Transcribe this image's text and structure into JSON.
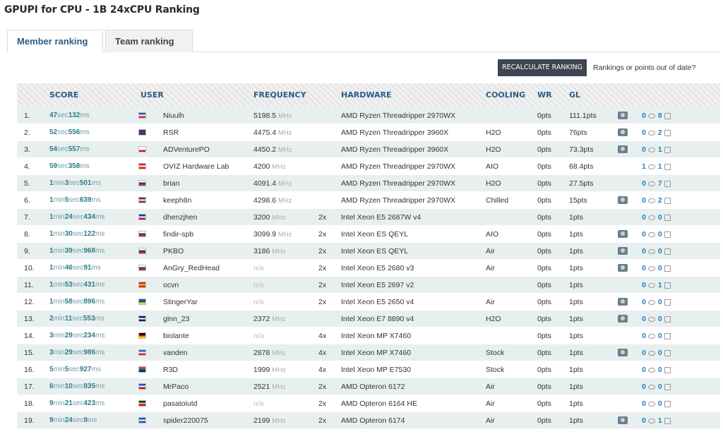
{
  "page": {
    "title": "GPUPI for CPU - 1B 24xCPU Ranking"
  },
  "tabs": [
    {
      "label": "Member ranking",
      "active": true
    },
    {
      "label": "Team ranking",
      "active": false
    }
  ],
  "toolbar": {
    "recalc_label": "RECALCULATE RANKING",
    "recalc_note": "Rankings or points out of date?"
  },
  "columns": {
    "score": "SCORE",
    "user": "USER",
    "frequency": "FREQUENCY",
    "hardware": "HARDWARE",
    "cooling": "COOLING",
    "wr": "WR",
    "gl": "GL"
  },
  "labels": {
    "mhz": "MHz",
    "na": "n/a"
  },
  "colors": {
    "accent": "#2b5d86",
    "score": "#2b7d86",
    "odd_row": "#e7f0ee",
    "button": "#3d4550",
    "count": "#2b7dba"
  },
  "rows": [
    {
      "rank": "1.",
      "score": [
        [
          "47",
          "sec"
        ],
        [
          "132",
          "ms"
        ]
      ],
      "flag": [
        "#2f5fb3",
        "#ffffff",
        "#d7263d"
      ],
      "user": "Niuulh",
      "freq": "5198.5",
      "cpus": "",
      "hw": "AMD Ryzen Threadripper 2970WX",
      "cooling": "",
      "wr": "0pts",
      "gl": "111.1pts",
      "cam": true,
      "comments": "0",
      "likes": "8"
    },
    {
      "rank": "2.",
      "score": [
        [
          "52",
          "sec"
        ],
        [
          "556",
          "ms"
        ]
      ],
      "flag": [
        "#1f3c88",
        "#c8102e",
        "#1f3c88"
      ],
      "user": "RSR",
      "freq": "4475.4",
      "cpus": "",
      "hw": "AMD Ryzen Threadripper 3960X",
      "cooling": "H2O",
      "wr": "0pts",
      "gl": "76pts",
      "cam": true,
      "comments": "0",
      "likes": "2"
    },
    {
      "rank": "3.",
      "score": [
        [
          "54",
          "sec"
        ],
        [
          "557",
          "ms"
        ]
      ],
      "flag": [
        "#ffffff",
        "#ffffff",
        "#dc143c"
      ],
      "user": "ADVenturePO",
      "freq": "4450.2",
      "cpus": "",
      "hw": "AMD Ryzen Threadripper 3960X",
      "cooling": "H2O",
      "wr": "0pts",
      "gl": "73.3pts",
      "cam": true,
      "comments": "0",
      "likes": "1"
    },
    {
      "rank": "4.",
      "score": [
        [
          "59",
          "sec"
        ],
        [
          "358",
          "ms"
        ]
      ],
      "flag": [
        "#d52b1e",
        "#ffffff",
        "#d52b1e"
      ],
      "user": "OVIZ Hardware Lab",
      "freq": "4200",
      "cpus": "",
      "hw": "AMD Ryzen Threadripper 2970WX",
      "cooling": "AIO",
      "wr": "0pts",
      "gl": "68.4pts",
      "cam": false,
      "comments": "1",
      "likes": "1"
    },
    {
      "rank": "5.",
      "score": [
        [
          "1",
          "min"
        ],
        [
          "3",
          "sec"
        ],
        [
          "501",
          "ms"
        ]
      ],
      "flag": [
        "#ffffff",
        "#0039a6",
        "#d52b1e"
      ],
      "user": "brian",
      "freq": "4091.4",
      "cpus": "",
      "hw": "AMD Ryzen Threadripper 2970WX",
      "cooling": "H2O",
      "wr": "0pts",
      "gl": "27.5pts",
      "cam": false,
      "comments": "0",
      "likes": "7"
    },
    {
      "rank": "6.",
      "score": [
        [
          "1",
          "min"
        ],
        [
          "5",
          "sec"
        ],
        [
          "639",
          "ms"
        ]
      ],
      "flag": [
        "#3c3b6e",
        "#ffffff",
        "#b22234"
      ],
      "user": "keeph8n",
      "freq": "4298.6",
      "cpus": "",
      "hw": "AMD Ryzen Threadripper 2970WX",
      "cooling": "Chilled",
      "wr": "0pts",
      "gl": "15pts",
      "cam": true,
      "comments": "0",
      "likes": "2"
    },
    {
      "rank": "7.",
      "score": [
        [
          "1",
          "min"
        ],
        [
          "24",
          "sec"
        ],
        [
          "434",
          "ms"
        ]
      ],
      "flag": [
        "#0038a8",
        "#ffffff",
        "#ce1126"
      ],
      "user": "dhenzjhen",
      "freq": "3200",
      "cpus": "2x",
      "hw": "Intel Xeon E5 2687W v4",
      "cooling": "",
      "wr": "0pts",
      "gl": "1pts",
      "cam": false,
      "comments": "0",
      "likes": "0"
    },
    {
      "rank": "8.",
      "score": [
        [
          "1",
          "min"
        ],
        [
          "30",
          "sec"
        ],
        [
          "122",
          "ms"
        ]
      ],
      "flag": [
        "#ffffff",
        "#0039a6",
        "#d52b1e"
      ],
      "user": "findir-spb",
      "freq": "3099.9",
      "cpus": "2x",
      "hw": "Intel Xeon ES QEYL",
      "cooling": "AIO",
      "wr": "0pts",
      "gl": "1pts",
      "cam": true,
      "comments": "0",
      "likes": "0"
    },
    {
      "rank": "9.",
      "score": [
        [
          "1",
          "min"
        ],
        [
          "39",
          "sec"
        ],
        [
          "968",
          "ms"
        ]
      ],
      "flag": [
        "#ffffff",
        "#11457e",
        "#d7141a"
      ],
      "user": "PKBO",
      "freq": "3186",
      "cpus": "2x",
      "hw": "Intel Xeon ES QEYL",
      "cooling": "Air",
      "wr": "0pts",
      "gl": "1pts",
      "cam": true,
      "comments": "0",
      "likes": "0"
    },
    {
      "rank": "10.",
      "score": [
        [
          "1",
          "min"
        ],
        [
          "46",
          "sec"
        ],
        [
          "91",
          "ms"
        ]
      ],
      "flag": [
        "#ffffff",
        "#0039a6",
        "#d52b1e"
      ],
      "user": "AnGry_RedHead",
      "freq": "",
      "cpus": "2x",
      "hw": "Intel Xeon E5 2680 v3",
      "cooling": "Air",
      "wr": "0pts",
      "gl": "1pts",
      "cam": true,
      "comments": "0",
      "likes": "0"
    },
    {
      "rank": "11.",
      "score": [
        [
          "1",
          "min"
        ],
        [
          "53",
          "sec"
        ],
        [
          "431",
          "ms"
        ]
      ],
      "flag": [
        "#da251d",
        "#ffcd00",
        "#da251d"
      ],
      "user": "ocvn",
      "freq": "",
      "cpus": "2x",
      "hw": "Intel Xeon E5 2697 v2",
      "cooling": "",
      "wr": "0pts",
      "gl": "1pts",
      "cam": false,
      "comments": "0",
      "likes": "1"
    },
    {
      "rank": "12.",
      "score": [
        [
          "1",
          "min"
        ],
        [
          "58",
          "sec"
        ],
        [
          "896",
          "ms"
        ]
      ],
      "flag": [
        "#0057b7",
        "#0057b7",
        "#ffd700"
      ],
      "user": "StingerYar",
      "freq": "",
      "cpus": "2x",
      "hw": "Intel Xeon E5 2650 v4",
      "cooling": "Air",
      "wr": "0pts",
      "gl": "1pts",
      "cam": true,
      "comments": "0",
      "likes": "0"
    },
    {
      "rank": "13.",
      "score": [
        [
          "2",
          "min"
        ],
        [
          "11",
          "sec"
        ],
        [
          "553",
          "ms"
        ]
      ],
      "flag": [
        "#00247d",
        "#ffffff",
        "#00247d"
      ],
      "user": "glnn_23",
      "freq": "2372",
      "cpus": "",
      "hw": "Intel Xeon E7 8890 v4",
      "cooling": "H2O",
      "wr": "0pts",
      "gl": "1pts",
      "cam": true,
      "comments": "0",
      "likes": "0"
    },
    {
      "rank": "14.",
      "score": [
        [
          "3",
          "min"
        ],
        [
          "29",
          "sec"
        ],
        [
          "234",
          "ms"
        ]
      ],
      "flag": [
        "#000000",
        "#dd0000",
        "#ffce00"
      ],
      "user": "biolante",
      "freq": "",
      "cpus": "4x",
      "hw": "Intel Xeon MP X7460",
      "cooling": "",
      "wr": "0pts",
      "gl": "1pts",
      "cam": false,
      "comments": "0",
      "likes": "0"
    },
    {
      "rank": "15.",
      "score": [
        [
          "3",
          "min"
        ],
        [
          "29",
          "sec"
        ],
        [
          "986",
          "ms"
        ]
      ],
      "flag": [
        "#2f5fb3",
        "#ffffff",
        "#d7263d"
      ],
      "user": "vanden",
      "freq": "2878",
      "cpus": "4x",
      "hw": "Intel Xeon MP X7460",
      "cooling": "Stock",
      "wr": "0pts",
      "gl": "1pts",
      "cam": true,
      "comments": "0",
      "likes": "0"
    },
    {
      "rank": "16.",
      "score": [
        [
          "5",
          "min"
        ],
        [
          "5",
          "sec"
        ],
        [
          "927",
          "ms"
        ]
      ],
      "flag": [
        "#de3831",
        "#007a4d",
        "#002395"
      ],
      "user": "R3D",
      "freq": "1999",
      "cpus": "4x",
      "hw": "Intel Xeon MP E7530",
      "cooling": "Stock",
      "wr": "0pts",
      "gl": "1pts",
      "cam": false,
      "comments": "0",
      "likes": "0"
    },
    {
      "rank": "17.",
      "score": [
        [
          "6",
          "min"
        ],
        [
          "10",
          "sec"
        ],
        [
          "835",
          "ms"
        ]
      ],
      "flag": [
        "#0050f0",
        "#ffffff",
        "#ed0000"
      ],
      "user": "MrPaco",
      "freq": "2521",
      "cpus": "2x",
      "hw": "AMD Opteron 6172",
      "cooling": "Air",
      "wr": "0pts",
      "gl": "1pts",
      "cam": false,
      "comments": "0",
      "likes": "0"
    },
    {
      "rank": "18.",
      "score": [
        [
          "9",
          "min"
        ],
        [
          "21",
          "sec"
        ],
        [
          "423",
          "ms"
        ]
      ],
      "flag": [
        "#002b7f",
        "#fcd116",
        "#ce1126"
      ],
      "user": "pasatoiutd",
      "freq": "",
      "cpus": "2x",
      "hw": "AMD Opteron 6164 HE",
      "cooling": "Air",
      "wr": "0pts",
      "gl": "1pts",
      "cam": false,
      "comments": "0",
      "likes": "0"
    },
    {
      "rank": "19.",
      "score": [
        [
          "9",
          "min"
        ],
        [
          "24",
          "sec"
        ],
        [
          "9",
          "ms"
        ]
      ],
      "flag": [
        "#0d5eaf",
        "#ffffff",
        "#0d5eaf"
      ],
      "user": "spider220075",
      "freq": "2199",
      "cpus": "2x",
      "hw": "AMD Opteron 6174",
      "cooling": "Air",
      "wr": "0pts",
      "gl": "1pts",
      "cam": true,
      "comments": "0",
      "likes": "1"
    }
  ]
}
